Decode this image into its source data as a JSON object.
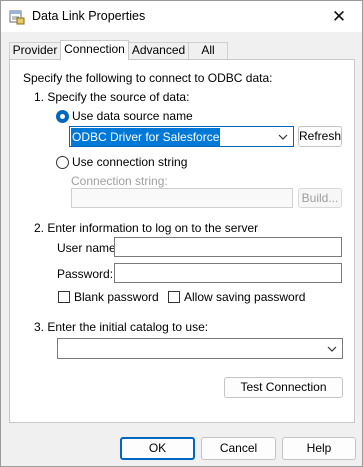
{
  "window": {
    "title": "Data Link Properties"
  },
  "tabs": [
    {
      "label": "Provider"
    },
    {
      "label": "Connection"
    },
    {
      "label": "Advanced"
    },
    {
      "label": "All"
    }
  ],
  "connection": {
    "intro": "Specify the following to connect to ODBC data:",
    "step1_label": "1. Specify the source of data:",
    "use_dsn_label": "Use data source name",
    "dsn_value": "ODBC Driver for Salesforce",
    "refresh_label": "Refresh",
    "use_conn_string_label": "Use connection string",
    "conn_string_label": "Connection string:",
    "conn_string_value": "",
    "build_label": "Build...",
    "step2_label": "2. Enter information to log on to the server",
    "username_label": "User name:",
    "username_value": "",
    "password_label": "Password:",
    "password_value": "",
    "blank_password_label": "Blank password",
    "allow_saving_label": "Allow saving password",
    "step3_label": "3. Enter the initial catalog to use:",
    "catalog_value": "",
    "test_connection_label": "Test Connection"
  },
  "footer": {
    "ok_label": "OK",
    "cancel_label": "Cancel",
    "help_label": "Help"
  }
}
